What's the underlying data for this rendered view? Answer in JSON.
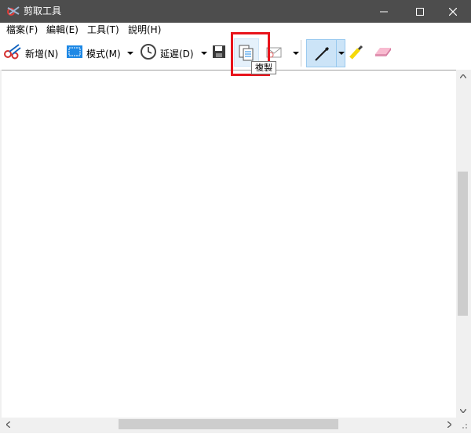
{
  "window": {
    "title": "剪取工具"
  },
  "menu": [
    {
      "label": "檔案(F)"
    },
    {
      "label": "編輯(E)"
    },
    {
      "label": "工具(T)"
    },
    {
      "label": "說明(H)"
    }
  ],
  "toolbar": {
    "new_label": "新增(N)",
    "mode_label": "模式(M)",
    "delay_label": "延遲(D)",
    "copy_tooltip": "複製"
  },
  "colors": {
    "titlebar": "#4d4d4d",
    "highlight": "#e8141c",
    "pen_selected": "#cce4f7"
  }
}
